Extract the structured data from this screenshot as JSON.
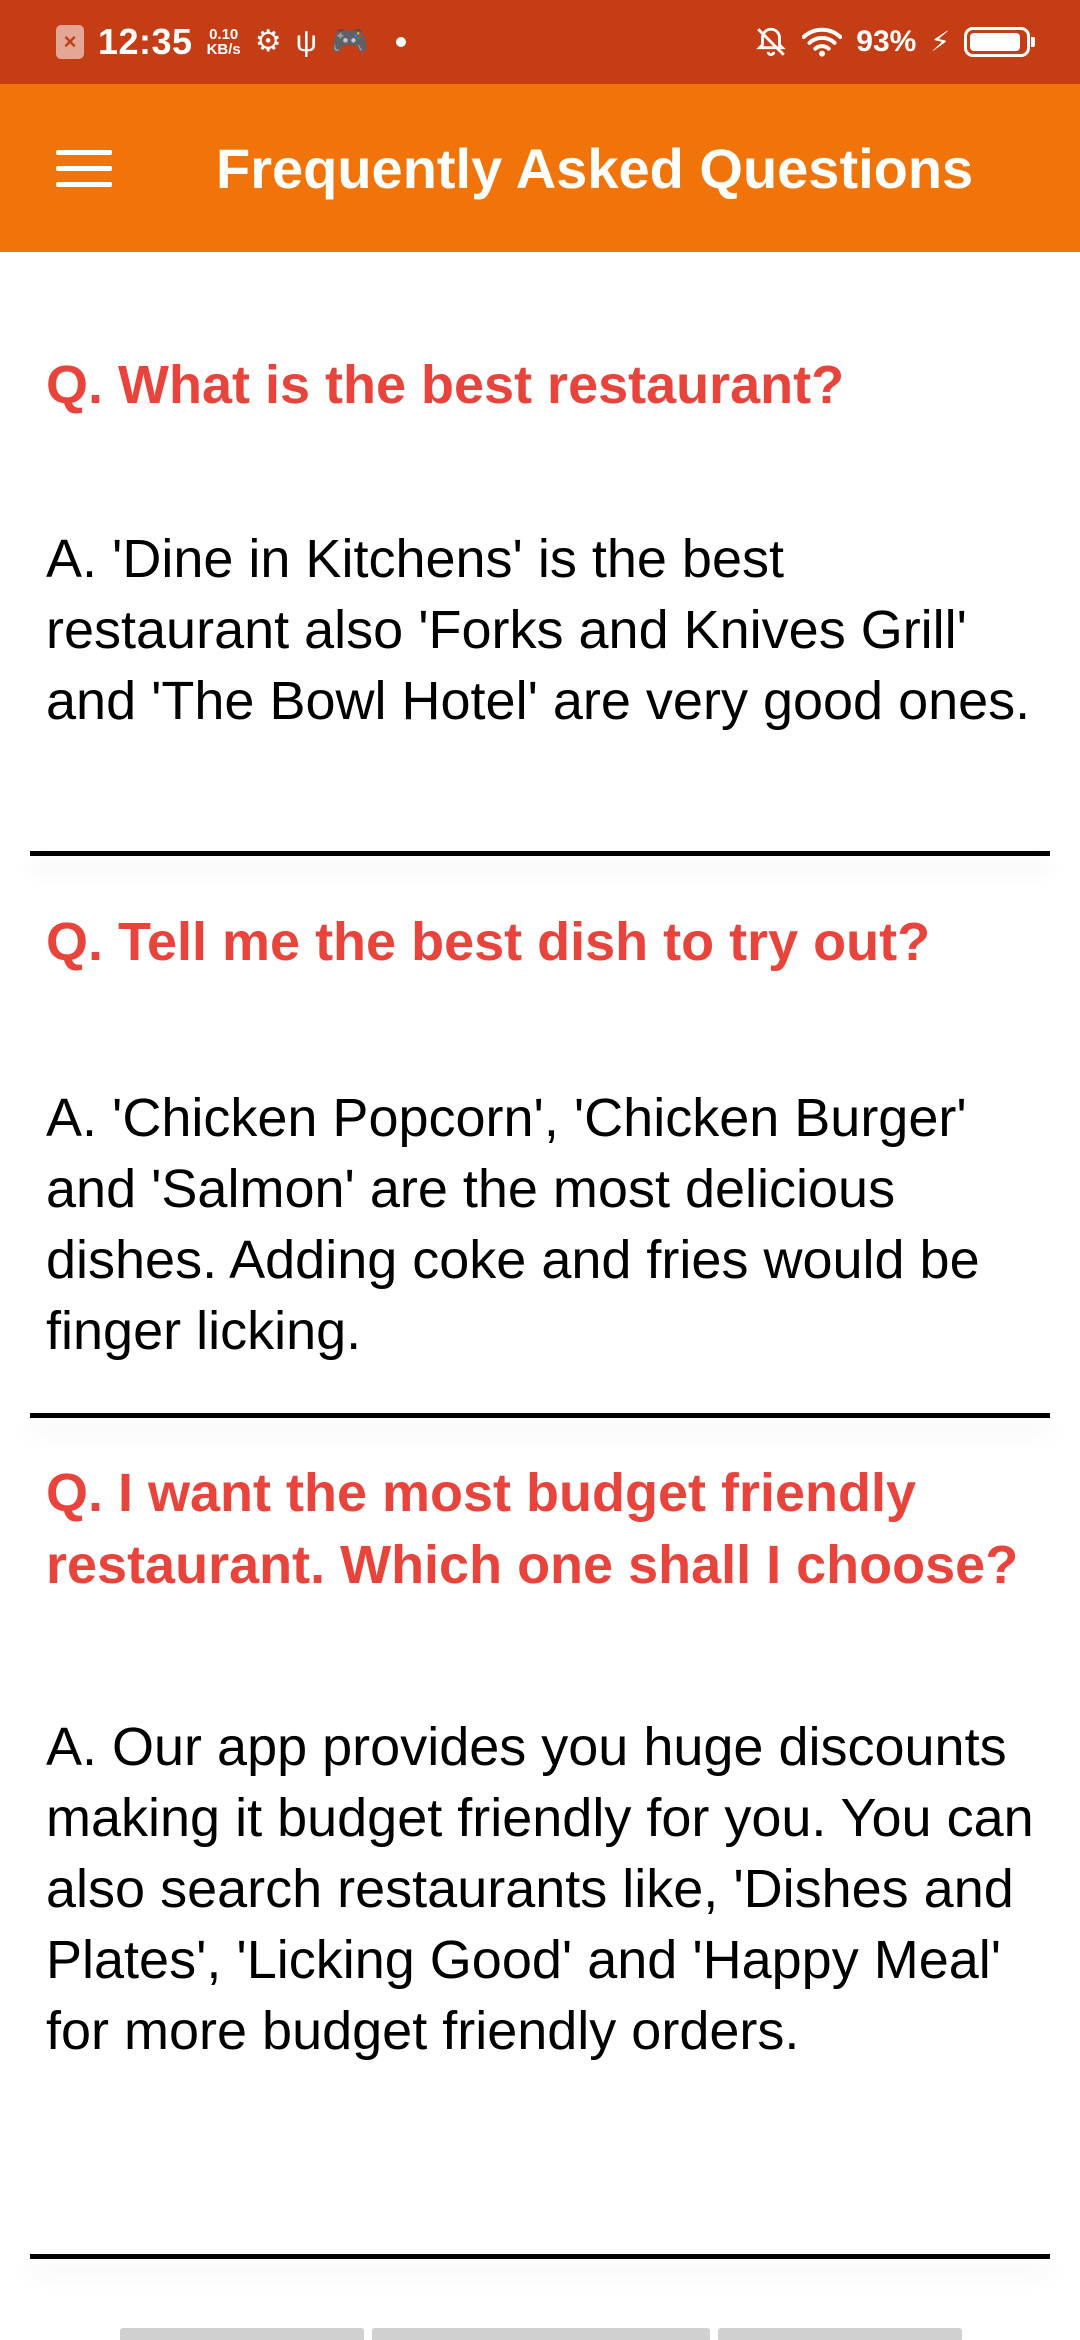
{
  "status_bar": {
    "time": "12:35",
    "net_speed_value": "0.10",
    "net_speed_unit": "KB/s",
    "battery": "93%",
    "battery_level": 0.93
  },
  "app_bar": {
    "title": "Frequently Asked Questions",
    "menu_icon": "hamburger-menu-icon"
  },
  "faq": [
    {
      "question": "Q. What is the best restaurant?",
      "answer": "A. 'Dine in Kitchens' is the best restaurant also 'Forks and Knives Grill' and 'The Bowl Hotel' are very good ones."
    },
    {
      "question": "Q. Tell me the best dish to try out?",
      "answer": "A. 'Chicken Popcorn', 'Chicken Burger' and 'Salmon' are the most delicious dishes. Adding coke and fries would be finger licking."
    },
    {
      "question": "Q. I want the most budget friendly restaurant. Which one shall I choose?",
      "answer": "A. Our app provides you huge discounts making it budget friendly for you. You can also search restaurants like, 'Dishes and Plates', 'Licking Good' and 'Happy Meal' for more budget friendly orders."
    }
  ],
  "colors": {
    "status_bar": "#c43d14",
    "app_bar": "#f07409",
    "question_text": "#e8443c",
    "answer_text": "#000000"
  }
}
